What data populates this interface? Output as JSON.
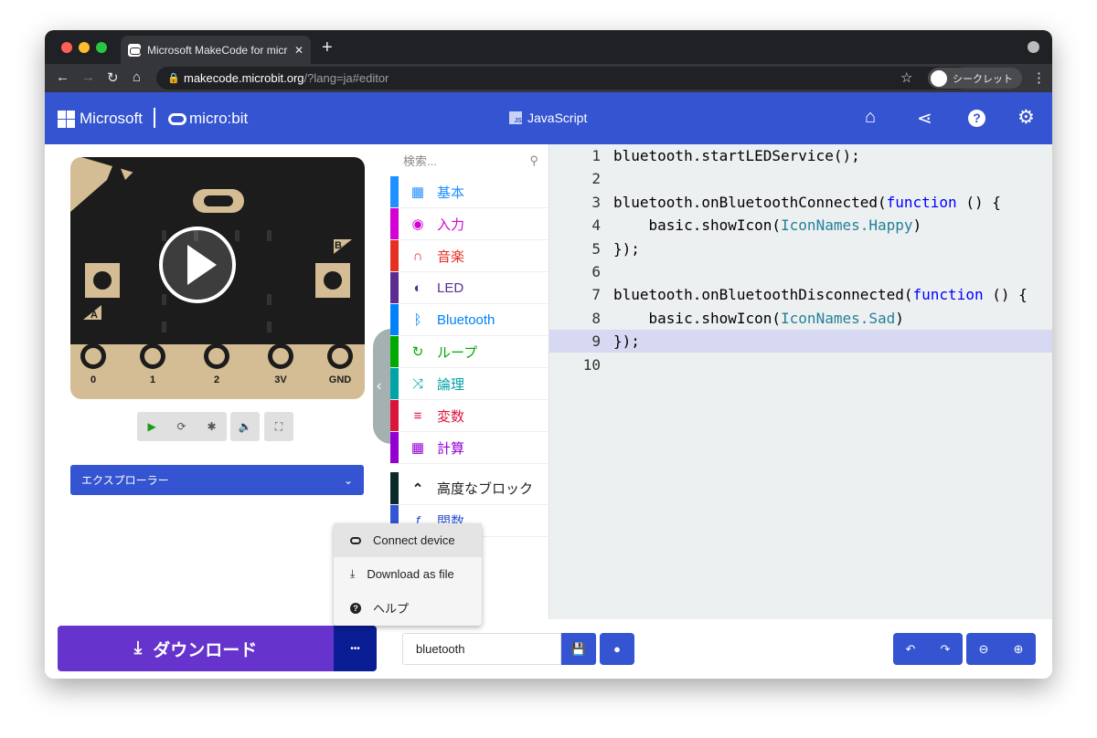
{
  "browser": {
    "tab_title": "Microsoft MakeCode for micro:",
    "url_host": "makecode.microbit.org",
    "url_rest": "/?lang=ja#editor",
    "profile": "シークレット"
  },
  "header": {
    "microsoft": "Microsoft",
    "microbit": "micro:bit",
    "mode": "JavaScript",
    "accent": "#3454d1"
  },
  "simulator": {
    "pins": [
      "0",
      "1",
      "2",
      "3V",
      "GND"
    ],
    "button_a": "A",
    "button_b": "B"
  },
  "explorer": {
    "label": "エクスプローラー"
  },
  "toolbox": {
    "search_placeholder": "検索...",
    "categories": [
      {
        "label": "基本",
        "color": "#1e90ff",
        "icon": "grid-icon"
      },
      {
        "label": "入力",
        "color": "#d400d4",
        "icon": "target-icon"
      },
      {
        "label": "音楽",
        "color": "#e63022",
        "icon": "headphones-icon"
      },
      {
        "label": "LED",
        "color": "#5c2d91",
        "icon": "toggle-icon"
      },
      {
        "label": "Bluetooth",
        "color": "#0082fb",
        "icon": "bluetooth-icon"
      },
      {
        "label": "ループ",
        "color": "#00aa00",
        "icon": "refresh-icon"
      },
      {
        "label": "論理",
        "color": "#00a4a6",
        "icon": "shuffle-icon"
      },
      {
        "label": "変数",
        "color": "#dc143c",
        "icon": "list-icon"
      },
      {
        "label": "計算",
        "color": "#9400d3",
        "icon": "calculator-icon"
      }
    ],
    "advanced": "高度なブロック",
    "functions": "関数"
  },
  "code": {
    "lines": [
      "bluetooth.startLEDService();",
      "",
      "bluetooth.onBluetoothConnected(function () {",
      "    basic.showIcon(IconNames.Happy)",
      "});",
      "",
      "bluetooth.onBluetoothDisconnected(function () {",
      "    basic.showIcon(IconNames.Sad)",
      "});",
      ""
    ],
    "highlighted_line": 9
  },
  "menu": {
    "items": [
      "Connect device",
      "Download as file",
      "ヘルプ"
    ]
  },
  "bottom": {
    "download": "ダウンロード",
    "more": "•••",
    "project_name": "bluetooth"
  }
}
